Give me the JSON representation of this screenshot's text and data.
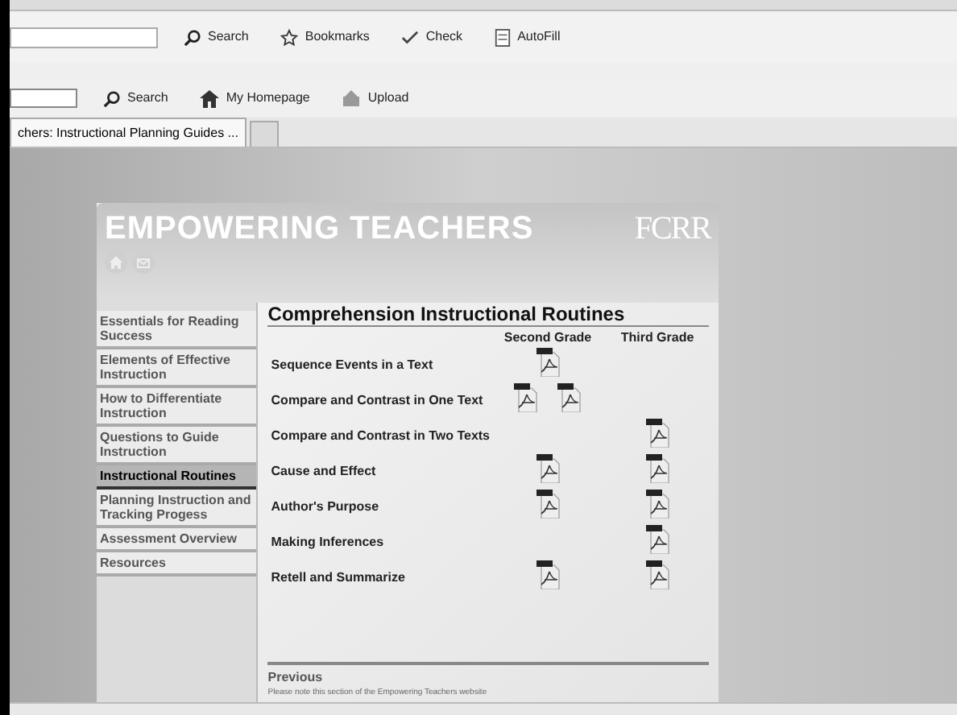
{
  "toolbar_1": {
    "items": [
      {
        "label": "Search",
        "kind": "search"
      },
      {
        "label": "Bookmarks",
        "kind": "star"
      },
      {
        "label": "Check",
        "kind": "check"
      },
      {
        "label": "AutoFill",
        "kind": "form"
      }
    ]
  },
  "toolbar_2": {
    "items": [
      {
        "label": "Search",
        "kind": "search"
      },
      {
        "label": "My Homepage",
        "kind": "home"
      },
      {
        "label": "Upload",
        "kind": "upload"
      }
    ]
  },
  "tabs": [
    {
      "label": "chers: Instructional Planning Guides ...",
      "selected": true
    },
    {
      "selected": false
    }
  ],
  "site": {
    "title": "EMPOWERING TEACHERS",
    "logo": "FCRR",
    "sidebar": [
      {
        "label": "Essentials for Reading Success",
        "selected": false
      },
      {
        "label": "Elements of Effective Instruction",
        "selected": false
      },
      {
        "label": "How to Differentiate Instruction",
        "selected": false
      },
      {
        "label": "Questions to Guide Instruction",
        "selected": false
      },
      {
        "label": "Instructional Routines",
        "selected": true
      },
      {
        "label": "Planning Instruction and Tracking Progess",
        "selected": false
      },
      {
        "label": "Assessment Overview",
        "selected": false
      },
      {
        "label": "Resources",
        "selected": false
      }
    ],
    "heading": "Comprehension Instructional Routines",
    "columns": [
      "Second Grade",
      "Third Grade"
    ],
    "rows": [
      {
        "label": "Sequence Events in a Text",
        "second_grade": [
          {
            "kind": "pdf"
          }
        ]
      },
      {
        "label": "Compare and Contrast in One Text",
        "second_grade": [
          {
            "kind": "pdf"
          },
          {
            "kind": "pdf"
          }
        ]
      },
      {
        "label": "Compare and Contrast in Two Texts",
        "third_grade": [
          {
            "kind": "pdf"
          }
        ]
      },
      {
        "label": "Cause and Effect",
        "second_grade": [
          {
            "kind": "pdf"
          }
        ],
        "third_grade": [
          {
            "kind": "pdf"
          }
        ]
      },
      {
        "label": "Author's Purpose",
        "second_grade": [
          {
            "kind": "pdf"
          }
        ],
        "third_grade": [
          {
            "kind": "pdf"
          }
        ]
      },
      {
        "label": "Making Inferences",
        "third_grade": [
          {
            "kind": "pdf"
          }
        ]
      },
      {
        "label": "Retell and Summarize",
        "second_grade": [
          {
            "kind": "pdf"
          }
        ],
        "third_grade": [
          {
            "kind": "pdf"
          }
        ]
      }
    ],
    "footer_title": "Previous",
    "footer_note": "Please note this section of the Empowering Teachers website"
  }
}
